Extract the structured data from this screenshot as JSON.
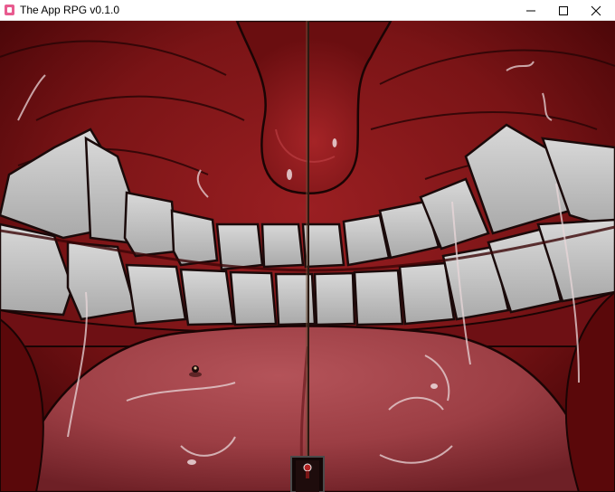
{
  "window": {
    "title": "The App RPG v0.1.0",
    "icon": "app-icon",
    "controls": [
      "minimize-icon",
      "maximize-icon",
      "close-icon"
    ]
  },
  "scene": {
    "description_tags": [
      "mouth-interior",
      "teeth",
      "tongue",
      "uvula",
      "rope",
      "player-sprite",
      "exit-door"
    ],
    "colors": {
      "flesh_dark": "#5e0a0c",
      "flesh_mid": "#8f1a1c",
      "tongue": "#a8464c",
      "tooth": "#c9c9c9",
      "outline": "#1a0a0a"
    }
  }
}
